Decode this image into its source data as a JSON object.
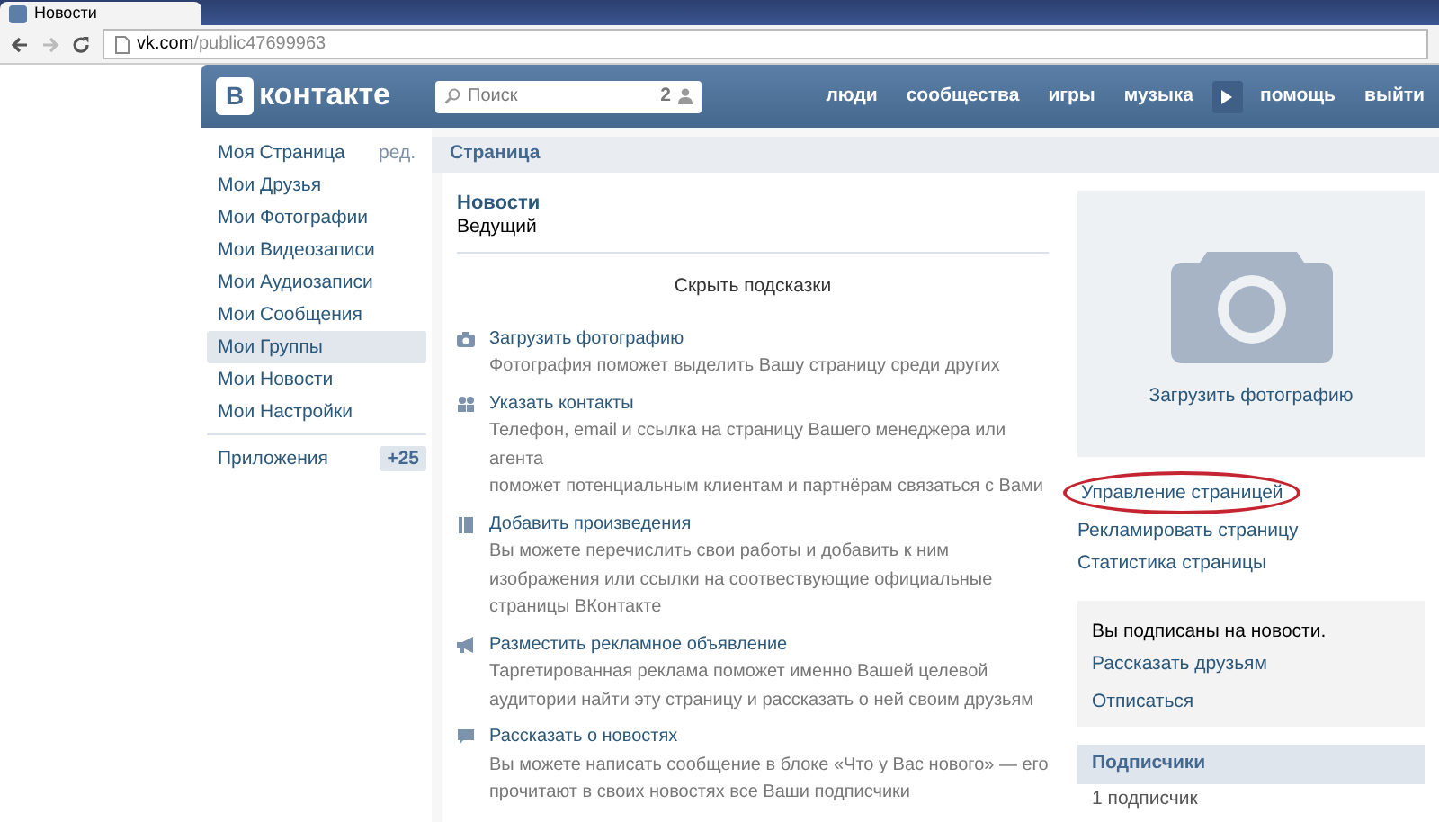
{
  "browser": {
    "tab_title": "Новости",
    "url_host": "vk.com",
    "url_path": "/public47699963"
  },
  "header": {
    "logo_letter": "В",
    "logo_text": "контакте",
    "search": {
      "placeholder": "Поиск",
      "count": "2"
    },
    "nav": [
      {
        "label": "люди",
        "kind": "link"
      },
      {
        "label": "сообщества",
        "kind": "link"
      },
      {
        "label": "игры",
        "kind": "link"
      },
      {
        "label": "музыка",
        "kind": "link"
      },
      {
        "kind": "play"
      },
      {
        "label": "помощь",
        "kind": "link"
      },
      {
        "label": "выйти",
        "kind": "link"
      }
    ]
  },
  "sidebar": {
    "items": [
      {
        "label": "Моя Страница",
        "extra": "ред.",
        "selected": false
      },
      {
        "label": "Мои Друзья",
        "selected": false
      },
      {
        "label": "Мои Фотографии",
        "selected": false
      },
      {
        "label": "Мои Видеозаписи",
        "selected": false
      },
      {
        "label": "Мои Аудиозаписи",
        "selected": false
      },
      {
        "label": "Мои Сообщения",
        "selected": false
      },
      {
        "label": "Мои Группы",
        "selected": true
      },
      {
        "label": "Мои Новости",
        "selected": false
      },
      {
        "label": "Мои Настройки",
        "selected": false
      }
    ],
    "apps": {
      "label": "Приложения",
      "badge": "+25"
    }
  },
  "main": {
    "header": "Страница",
    "page_name": "Новости",
    "page_status": "Ведущий",
    "hide_tips": "Скрыть подсказки",
    "tips": [
      {
        "kind": "camera",
        "title": "Загрузить фотографию",
        "desc": [
          "Фотография поможет выделить Вашу страницу среди других"
        ]
      },
      {
        "kind": "contacts",
        "title": "Указать контакты",
        "desc": [
          "Телефон, email и ссылка на страницу Вашего менеджера или агента",
          "поможет потенциальным клиентам и партнёрам связаться с Вами"
        ]
      },
      {
        "kind": "book",
        "title": "Добавить произведения",
        "desc": [
          "Вы можете перечислить свои работы и добавить к ним изображения или ссылки на соотвествующие официальные страницы ВКонтакте"
        ]
      },
      {
        "kind": "megaphone",
        "title": "Разместить рекламное объявление",
        "desc": [
          "Таргетированная реклама поможет именно Вашей целевой аудитории найти эту страницу и рассказать о ней своим друзьям"
        ]
      },
      {
        "kind": "comment",
        "title": "Рассказать о новостях",
        "desc": [
          "Вы можете написать сообщение в блоке «Что у Вас нового» — его прочитают в своих новостях все Ваши подписчики"
        ]
      }
    ]
  },
  "right": {
    "upload_photo": "Загрузить фотографию",
    "actions": [
      {
        "label": "Управление страницей",
        "circled": true
      },
      {
        "label": "Рекламировать страницу",
        "circled": false
      },
      {
        "label": "Статистика страницы",
        "circled": false
      }
    ],
    "subscribed": {
      "text": "Вы подписаны на новости.",
      "links": [
        "Рассказать друзьям",
        "Отписаться"
      ]
    },
    "subscribers": {
      "title": "Подписчики",
      "count": "1 подписчик"
    }
  }
}
